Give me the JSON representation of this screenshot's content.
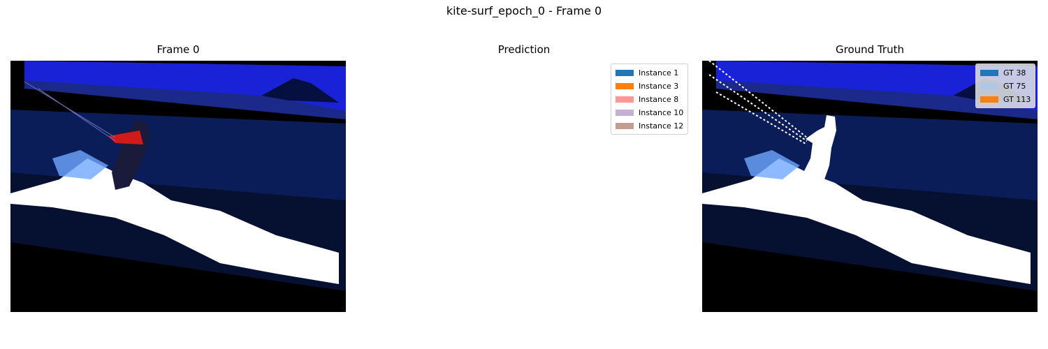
{
  "figure": {
    "suptitle": "kite-surf_epoch_0 - Frame 0"
  },
  "panels": {
    "frame": {
      "title": "Frame 0"
    },
    "prediction": {
      "title": "Prediction"
    },
    "ground_truth": {
      "title": "Ground Truth"
    }
  },
  "prediction_legend": [
    {
      "label": "Instance 1",
      "color": "#1f77b4"
    },
    {
      "label": "Instance 3",
      "color": "#ff7f0e"
    },
    {
      "label": "Instance 8",
      "color": "#ff9896"
    },
    {
      "label": "Instance 10",
      "color": "#c5b0d5"
    },
    {
      "label": "Instance 12",
      "color": "#c49c94"
    }
  ],
  "gt_legend": [
    {
      "label": "GT 38",
      "color": "#1f77b4"
    },
    {
      "label": "GT 75",
      "color": "#aec7e8"
    },
    {
      "label": "GT 113",
      "color": "#ff7f0e"
    }
  ],
  "colors": {
    "sky": "#1a22d8",
    "water": "#0a1a4a",
    "spray": "#ffffff",
    "rider": "#d11a1a",
    "mask": "#ffffff"
  }
}
